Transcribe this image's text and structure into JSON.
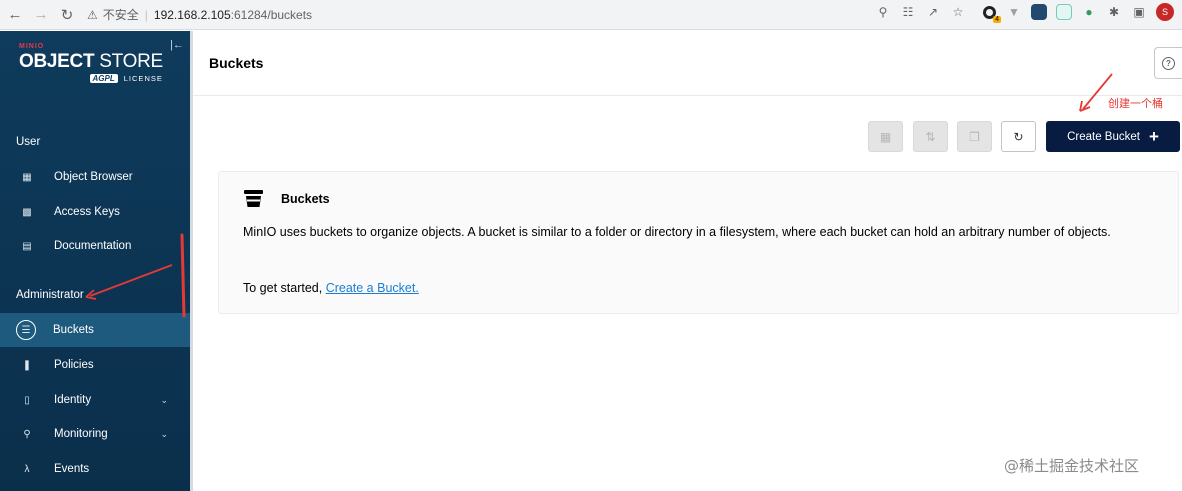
{
  "browser": {
    "security_label": "不安全",
    "url_host": "192.168.2.105",
    "url_path": ":61284/buckets",
    "profile_initial": "S",
    "extension_badge": "4"
  },
  "sidebar": {
    "logo": {
      "small": "MINIO",
      "brand_bold": "OBJECT",
      "brand_light": "STORE",
      "agpl": "AGPL",
      "license": "LICENSE"
    },
    "sections": [
      {
        "title": "User",
        "items": [
          {
            "label": "Object Browser",
            "icon": "object-browser-icon"
          },
          {
            "label": "Access Keys",
            "icon": "access-keys-icon"
          },
          {
            "label": "Documentation",
            "icon": "documentation-icon"
          }
        ]
      },
      {
        "title": "Administrator",
        "items": [
          {
            "label": "Buckets",
            "icon": "bucket-icon",
            "active": true
          },
          {
            "label": "Policies",
            "icon": "policies-icon"
          },
          {
            "label": "Identity",
            "icon": "identity-icon",
            "expandable": true
          },
          {
            "label": "Monitoring",
            "icon": "monitoring-icon",
            "expandable": true
          },
          {
            "label": "Events",
            "icon": "lambda-icon"
          }
        ]
      }
    ]
  },
  "header": {
    "title": "Buckets",
    "help_icon": "help-icon"
  },
  "toolbar": {
    "create_bucket_label": "Create Bucket",
    "icons": [
      "grid-view-icon",
      "replication-icon",
      "copy-icon",
      "refresh-icon",
      "plus-icon"
    ]
  },
  "info": {
    "title": "Buckets",
    "description": "MinIO uses buckets to organize objects. A bucket is similar to a folder or directory in a filesystem, where each bucket can hold an arbitrary number of objects.",
    "start_prefix": "To get started, ",
    "start_link": "Create a Bucket."
  },
  "annotations": {
    "create_bucket_note": "创建一个桶",
    "color": "#e53935"
  },
  "watermark": "@稀土掘金技术社区",
  "colors": {
    "sidebar": "#0f3b5c",
    "active_item": "#1e5a7e",
    "create_button": "#081c42",
    "link": "#1a7ed4"
  }
}
